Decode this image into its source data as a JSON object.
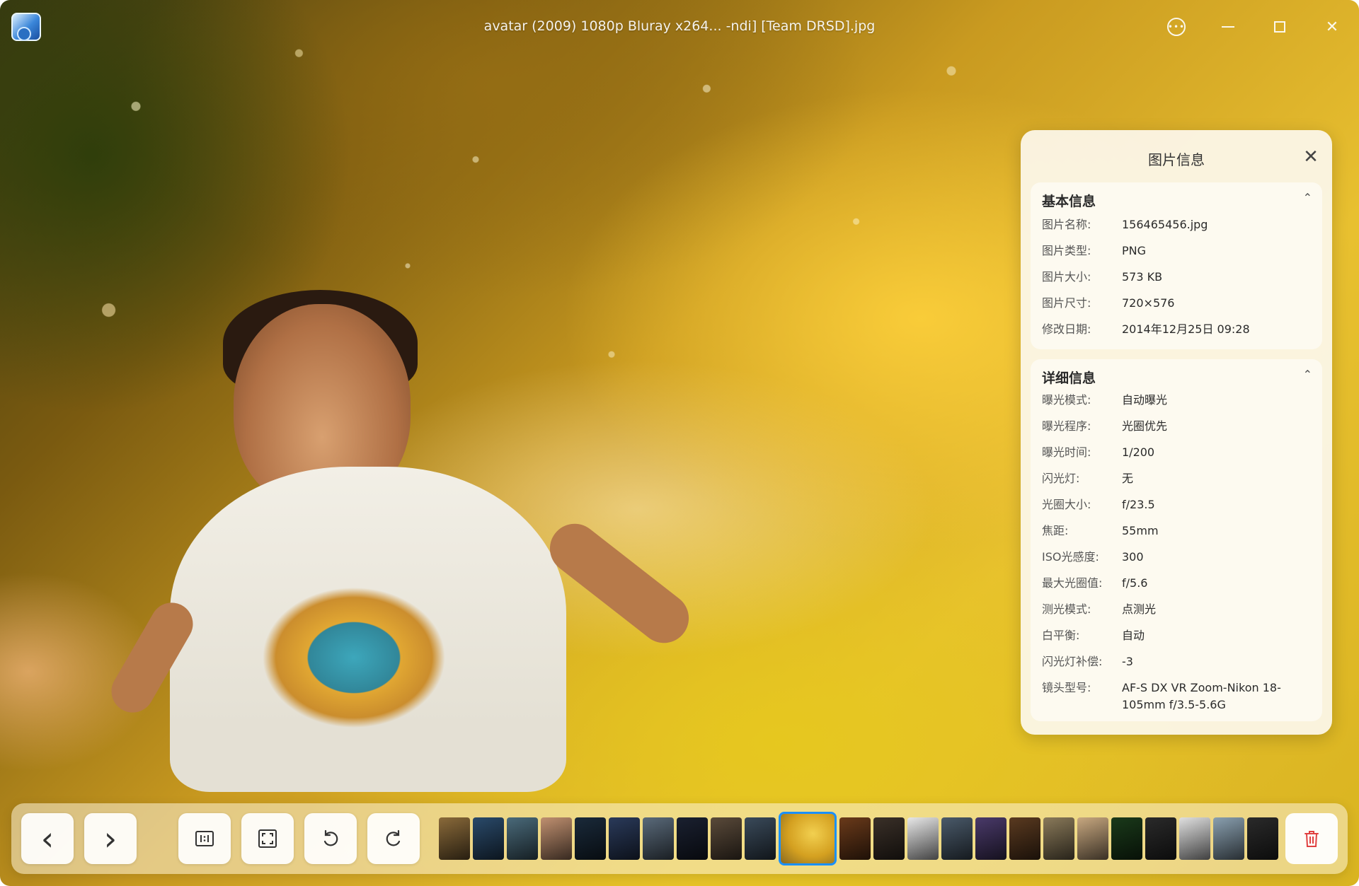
{
  "window": {
    "title": "avatar (2009) 1080p Bluray x264... -ndi] [Team DRSD].jpg",
    "more_icon": "more-options-icon",
    "minimize_icon": "minimize-icon",
    "maximize_icon": "maximize-icon",
    "close_icon": "close-icon",
    "more_glyph": "•••",
    "close_glyph": "✕"
  },
  "info_panel": {
    "title": "图片信息",
    "close_glyph": "✕",
    "basic": {
      "header": "基本信息",
      "chevron": "⌃",
      "rows": [
        {
          "label": "图片名称:",
          "value": "156465456.jpg"
        },
        {
          "label": "图片类型:",
          "value": "PNG"
        },
        {
          "label": "图片大小:",
          "value": "573 KB"
        },
        {
          "label": "图片尺寸:",
          "value": "720×576"
        },
        {
          "label": "修改日期:",
          "value": "2014年12月25日  09:28"
        }
      ]
    },
    "detail": {
      "header": "详细信息",
      "chevron": "⌃",
      "rows": [
        {
          "label": "曝光模式:",
          "value": "自动曝光"
        },
        {
          "label": "曝光程序:",
          "value": "光圈优先"
        },
        {
          "label": "曝光时间:",
          "value": "1/200"
        },
        {
          "label": "闪光灯:",
          "value": "无"
        },
        {
          "label": "光圈大小:",
          "value": "f/23.5"
        },
        {
          "label": "焦距:",
          "value": "55mm"
        },
        {
          "label": "ISO光感度:",
          "value": "300"
        },
        {
          "label": "最大光圈值:",
          "value": "f/5.6"
        },
        {
          "label": "测光模式:",
          "value": "点测光"
        },
        {
          "label": "白平衡:",
          "value": "自动"
        },
        {
          "label": "闪光灯补偿:",
          "value": "-3"
        },
        {
          "label": "镜头型号:",
          "value": "AF-S DX VR Zoom-Nikon 18-105mm f/3.5-5.6G"
        }
      ]
    }
  },
  "toolbar": {
    "prev_glyph": "‹",
    "next_glyph": "›",
    "thumbnails_colors": [
      "#8a6a3a",
      "#2a4a6a",
      "#4a6a7a",
      "#c09070",
      "#1a2a3a",
      "#2a3a5a",
      "#5a6a7a",
      "#1a2030",
      "#5a4a3a",
      "#3a4a5a",
      "#d4a020",
      "#6a3a1a",
      "#3a3028",
      "#e8e8e8",
      "#4a5a6a",
      "#4a3a6a",
      "#5a3a20",
      "#8a7a5a",
      "#c8a880",
      "#1a3a1a",
      "#2a2a2a",
      "#e0e0e0",
      "#8aa0b0",
      "#2a2a2a"
    ],
    "active_index": 10,
    "accent_color": "#1a90ff",
    "delete_color": "#e04040"
  }
}
